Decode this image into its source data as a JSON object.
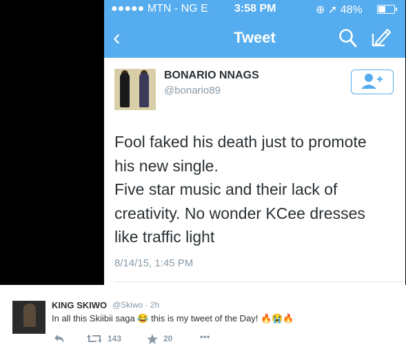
{
  "status_bar": {
    "carrier": "●●●●● MTN - NG  E",
    "time": "3:58 PM",
    "battery_text": "48%",
    "battery_level": 0.48
  },
  "nav": {
    "back_glyph": "‹",
    "title": "Tweet",
    "icons": [
      "search-icon",
      "compose-icon"
    ]
  },
  "tweet": {
    "author_name": "BONARIO NNAGS",
    "author_handle": "@bonario89",
    "follow_icon": "add-user-icon",
    "text_lines": [
      "Fool faked his death just to promote",
      "his new single.",
      "Five star music and their lack of",
      "creativity. No wonder KCee dresses",
      "like traffic light"
    ],
    "date": "8/14/15, 1:45 PM"
  },
  "retweet_card": {
    "author_name": "KING SKIWO",
    "author_handle": "@Skiwo · 2h",
    "text": "In all this Skiibii saga 😂 this is my tweet of the   Day! 🔥😭🔥",
    "retweet_count": "143",
    "favorite_count": "20",
    "icons": [
      "reply-icon",
      "retweet-icon",
      "favorite-icon",
      "more-icon"
    ]
  },
  "colors": {
    "twitter_blue": "#55acee",
    "text_dark": "#292f33",
    "text_grey": "#8899a6"
  }
}
